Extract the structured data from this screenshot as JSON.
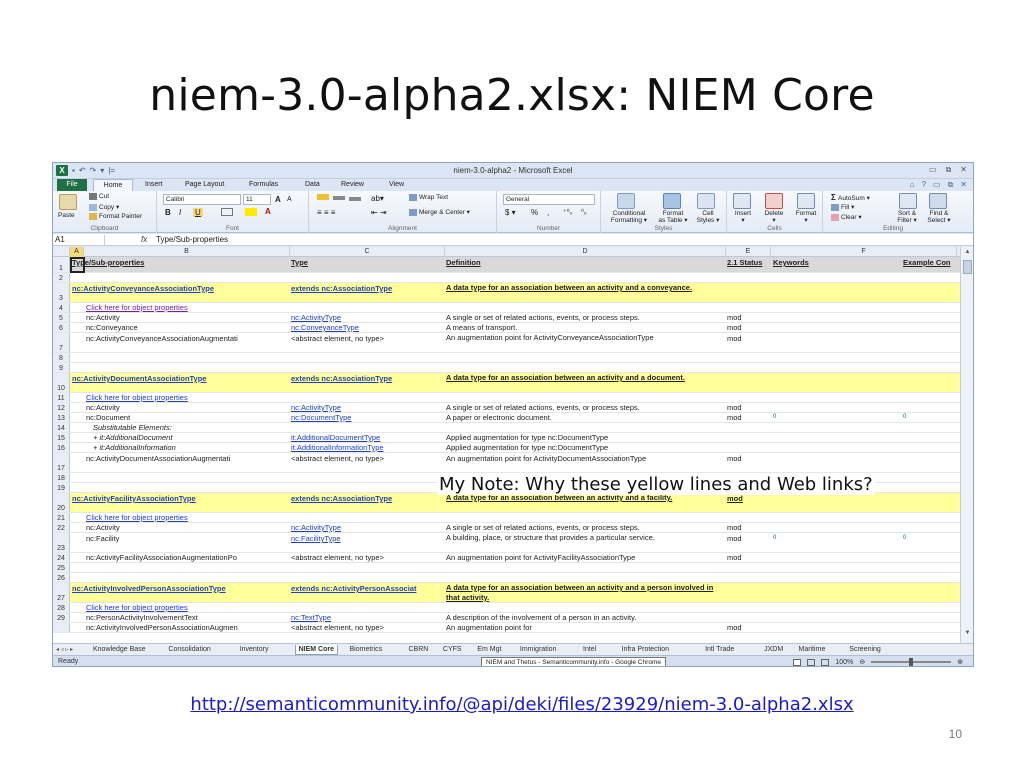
{
  "slide": {
    "title": "niem-3.0-alpha2.xlsx: NIEM Core",
    "note": "My Note: Why these yellow lines and Web links?",
    "url": "http://semanticommunity.info/@api/deki/files/23929/niem-3.0-alpha2.xlsx",
    "page_number": "10"
  },
  "window": {
    "title": "niem-3.0-alpha2  -  Microsoft Excel",
    "controls": [
      "▭",
      "⧉",
      "✕"
    ],
    "ribbon_controls": [
      "⌂",
      "?",
      "▭",
      "⧉",
      "✕"
    ],
    "qat": [
      "↶",
      "↷",
      "▾",
      "|="
    ]
  },
  "tabs": [
    "File",
    "Home",
    "Insert",
    "Page Layout",
    "Formulas",
    "Data",
    "Review",
    "View"
  ],
  "ribbon": {
    "clipboard": {
      "paste": "Paste",
      "cut": "Cut",
      "copy": "Copy ▾",
      "format_painter": "Format Painter",
      "label": "Clipboard"
    },
    "font": {
      "name": "Calibri",
      "size": "11",
      "bold": "B",
      "italic": "I",
      "underline": "U",
      "grow": "A",
      "shrink": "A",
      "label": "Font"
    },
    "alignment": {
      "wrap": "Wrap Text",
      "merge": "Merge & Center ▾",
      "label": "Alignment"
    },
    "number": {
      "format": "General",
      "currency": "$ ▾",
      "percent": "%",
      "comma": ",",
      "inc": "⁺⁰₀",
      "dec": "⁰₀",
      "label": "Number"
    },
    "styles": {
      "conditional": "Conditional\nFormatting ▾",
      "as_table": "Format\nas Table ▾",
      "cell": "Cell\nStyles ▾",
      "label": "Styles"
    },
    "cells": {
      "insert": "Insert\n▾",
      "delete": "Delete\n▾",
      "format": "Format\n▾",
      "label": "Cells"
    },
    "editing": {
      "autosum": "AutoSum ▾",
      "fill": "Fill ▾",
      "clear": "Clear ▾",
      "sort": "Sort &\nFilter ▾",
      "find": "Find &\nSelect ▾",
      "label": "Editing"
    }
  },
  "formula_bar": {
    "name_box": "A1",
    "fx": "fx",
    "value": "Type/Sub-properties"
  },
  "columns": [
    "A",
    "B",
    "C",
    "D",
    "E",
    "F"
  ],
  "rows": [
    {
      "n": "1",
      "h": 16,
      "style": "gray",
      "cells": [
        {
          "col": "A",
          "text": "Type/Sub-properties",
          "cls": "b u"
        },
        {
          "col": "C",
          "text": "Type",
          "cls": "b u"
        },
        {
          "col": "D",
          "text": "Definition",
          "cls": "b u"
        },
        {
          "col": "E",
          "text": "2.1 Status",
          "cls": "b u"
        },
        {
          "col": "F",
          "text": "Keywords",
          "cls": "b u"
        },
        {
          "col": "G",
          "text": "Example Con",
          "cls": "b u"
        }
      ]
    },
    {
      "n": "2",
      "h": 10,
      "style": "",
      "cells": []
    },
    {
      "n": "3",
      "h": 20,
      "style": "yellow",
      "cells": [
        {
          "col": "A",
          "text": "nc:ActivityConveyanceAssociationType",
          "cls": "b link"
        },
        {
          "col": "C",
          "text": "extends nc:AssociationType",
          "cls": "b link"
        },
        {
          "col": "D",
          "text": "A data type for an association between an activity and a conveyance.",
          "cls": "b u wrap"
        }
      ]
    },
    {
      "n": "4",
      "h": 10,
      "style": "",
      "cells": [
        {
          "col": "B",
          "text": "Click here for object properties",
          "cls": "link-purple"
        }
      ]
    },
    {
      "n": "5",
      "h": 10,
      "style": "",
      "cells": [
        {
          "col": "B",
          "text": "nc:Activity"
        },
        {
          "col": "C",
          "text": "nc:ActivityType",
          "cls": "link"
        },
        {
          "col": "D",
          "text": "A single or set of related actions, events, or process steps."
        },
        {
          "col": "E",
          "text": "mod"
        }
      ]
    },
    {
      "n": "6",
      "h": 10,
      "style": "",
      "cells": [
        {
          "col": "B",
          "text": "nc:Conveyance"
        },
        {
          "col": "C",
          "text": "nc:ConveyanceType",
          "cls": "link"
        },
        {
          "col": "D",
          "text": "A means of transport."
        },
        {
          "col": "E",
          "text": "mod"
        }
      ]
    },
    {
      "n": "7",
      "h": 20,
      "style": "",
      "cells": [
        {
          "col": "B",
          "text": "nc:ActivityConveyanceAssociationAugmentati"
        },
        {
          "col": "C",
          "text": "<abstract element, no type>"
        },
        {
          "col": "D",
          "text": "An augmentation point for ActivityConveyanceAssociationType",
          "cls": "wrap"
        },
        {
          "col": "E",
          "text": "mod"
        }
      ]
    },
    {
      "n": "8",
      "h": 10,
      "style": "",
      "cells": []
    },
    {
      "n": "9",
      "h": 10,
      "style": "",
      "cells": []
    },
    {
      "n": "10",
      "h": 20,
      "style": "yellow",
      "cells": [
        {
          "col": "A",
          "text": "nc:ActivityDocumentAssociationType",
          "cls": "b link"
        },
        {
          "col": "C",
          "text": "extends nc:AssociationType",
          "cls": "b link"
        },
        {
          "col": "D",
          "text": "A data type for an association between an activity and a document.",
          "cls": "b u wrap"
        }
      ]
    },
    {
      "n": "11",
      "h": 10,
      "style": "",
      "cells": [
        {
          "col": "B",
          "text": "Click here for object properties",
          "cls": "link"
        }
      ]
    },
    {
      "n": "12",
      "h": 10,
      "style": "",
      "cells": [
        {
          "col": "B",
          "text": "nc:Activity"
        },
        {
          "col": "C",
          "text": "nc:ActivityType",
          "cls": "link"
        },
        {
          "col": "D",
          "text": "A single or set of related actions, events, or process steps."
        },
        {
          "col": "E",
          "text": "mod"
        }
      ]
    },
    {
      "n": "13",
      "h": 10,
      "style": "",
      "cells": [
        {
          "col": "B",
          "text": "nc:Document"
        },
        {
          "col": "C",
          "text": "nc:DocumentType",
          "cls": "link"
        },
        {
          "col": "D",
          "text": "A paper or electronic document."
        },
        {
          "col": "E",
          "text": "mod"
        },
        {
          "col": "F",
          "text": "0",
          "cls": "tri"
        },
        {
          "col": "G",
          "text": "0",
          "cls": "tri"
        }
      ]
    },
    {
      "n": "14",
      "h": 10,
      "style": "",
      "cells": [
        {
          "col": "B2",
          "text": "Substitutable Elements:",
          "cls": "it"
        }
      ]
    },
    {
      "n": "15",
      "h": 10,
      "style": "",
      "cells": [
        {
          "col": "B2",
          "text": "+ it:AdditionalDocument",
          "cls": "it"
        },
        {
          "col": "C",
          "text": "it:AdditionalDocumentType",
          "cls": "link"
        },
        {
          "col": "D",
          "text": "Applied augmentation for type nc:DocumentType"
        }
      ]
    },
    {
      "n": "16",
      "h": 10,
      "style": "",
      "cells": [
        {
          "col": "B2",
          "text": "+ it:AdditionalInformation",
          "cls": "it"
        },
        {
          "col": "C",
          "text": "it:AdditionalInformationType",
          "cls": "link"
        },
        {
          "col": "D",
          "text": "Applied augmentation for type nc:DocumentType"
        }
      ]
    },
    {
      "n": "17",
      "h": 20,
      "style": "",
      "cells": [
        {
          "col": "B",
          "text": "nc:ActivityDocumentAssociationAugmentati"
        },
        {
          "col": "C",
          "text": "<abstract element, no type>"
        },
        {
          "col": "D",
          "text": "An augmentation point for ActivityDocumentAssociationType"
        },
        {
          "col": "E",
          "text": "mod"
        }
      ]
    },
    {
      "n": "18",
      "h": 10,
      "style": "",
      "cells": []
    },
    {
      "n": "19",
      "h": 10,
      "style": "",
      "cells": []
    },
    {
      "n": "20",
      "h": 20,
      "style": "yellow",
      "cells": [
        {
          "col": "A",
          "text": "nc:ActivityFacilityAssociationType",
          "cls": "b link"
        },
        {
          "col": "C",
          "text": "extends nc:AssociationType",
          "cls": "b link"
        },
        {
          "col": "D",
          "text": "A data type for an association between an activity and a facility.",
          "cls": "b u wrap"
        },
        {
          "col": "E",
          "text": "mod",
          "cls": "b u"
        }
      ]
    },
    {
      "n": "21",
      "h": 10,
      "style": "",
      "cells": [
        {
          "col": "B",
          "text": "Click here for object properties",
          "cls": "link"
        }
      ]
    },
    {
      "n": "22",
      "h": 10,
      "style": "",
      "cells": [
        {
          "col": "B",
          "text": "nc:Activity"
        },
        {
          "col": "C",
          "text": "nc:ActivityType",
          "cls": "link"
        },
        {
          "col": "D",
          "text": "A single or set of related actions, events, or process steps."
        },
        {
          "col": "E",
          "text": "mod"
        }
      ]
    },
    {
      "n": "23",
      "h": 20,
      "style": "",
      "cells": [
        {
          "col": "B",
          "text": "nc:Facility"
        },
        {
          "col": "C",
          "text": "nc:FacilityType",
          "cls": "link"
        },
        {
          "col": "D",
          "text": "A building, place, or structure that provides a particular service.",
          "cls": "wrap"
        },
        {
          "col": "E",
          "text": "mod"
        },
        {
          "col": "F",
          "text": "0",
          "cls": "tri"
        },
        {
          "col": "G",
          "text": "0",
          "cls": "tri"
        }
      ]
    },
    {
      "n": "24",
      "h": 10,
      "style": "",
      "cells": [
        {
          "col": "B",
          "text": "nc:ActivityFacilityAssociationAugmentationPo"
        },
        {
          "col": "C",
          "text": "<abstract element, no type>"
        },
        {
          "col": "D",
          "text": "An augmentation point for ActivityFacilityAssociationType"
        },
        {
          "col": "E",
          "text": "mod"
        }
      ]
    },
    {
      "n": "25",
      "h": 10,
      "style": "",
      "cells": []
    },
    {
      "n": "26",
      "h": 10,
      "style": "",
      "cells": []
    },
    {
      "n": "27",
      "h": 20,
      "style": "yellow",
      "cells": [
        {
          "col": "A",
          "text": "nc:ActivityInvolvedPersonAssociationType",
          "cls": "b link"
        },
        {
          "col": "C",
          "text": "extends nc:ActivityPersonAssociat",
          "cls": "b link"
        },
        {
          "col": "D",
          "text": "A data type for an association between an activity and a person involved in that activity.",
          "cls": "b u wrap"
        }
      ]
    },
    {
      "n": "28",
      "h": 10,
      "style": "",
      "cells": [
        {
          "col": "B",
          "text": "Click here for object properties",
          "cls": "link"
        }
      ]
    },
    {
      "n": "29",
      "h": 10,
      "style": "",
      "cells": [
        {
          "col": "B",
          "text": "nc:PersonActivityInvolvementText"
        },
        {
          "col": "C",
          "text": "nc:TextType",
          "cls": "link"
        },
        {
          "col": "D",
          "text": "A description of the involvement of a person in an activity."
        }
      ]
    },
    {
      "n": "",
      "h": 10,
      "style": "",
      "cells": [
        {
          "col": "B",
          "text": "nc:ActivityInvolvedPersonAssociationAugmen"
        },
        {
          "col": "C",
          "text": "<abstract element, no type>"
        },
        {
          "col": "D",
          "text": "An augmentation point for"
        },
        {
          "col": "E",
          "text": "mod"
        }
      ]
    }
  ],
  "sheet_nav": "◂ ◃ ▹ ▸",
  "sheet_tabs": [
    "Knowledge Base",
    "Consolidation",
    "Inventory",
    "NIEM Core",
    "Biometrics",
    "CBRN",
    "CYFS",
    "Em Mgt",
    "Immigration",
    "Intel",
    "Infra Protection",
    "Intl Trade",
    "JXDM",
    "Maritime",
    "Screening"
  ],
  "active_sheet": "NIEM Core",
  "status": {
    "ready": "Ready",
    "tooltip": "NIEM and Thetus - Semanticommunity.info - Google Chrome",
    "zoom": "100%"
  }
}
